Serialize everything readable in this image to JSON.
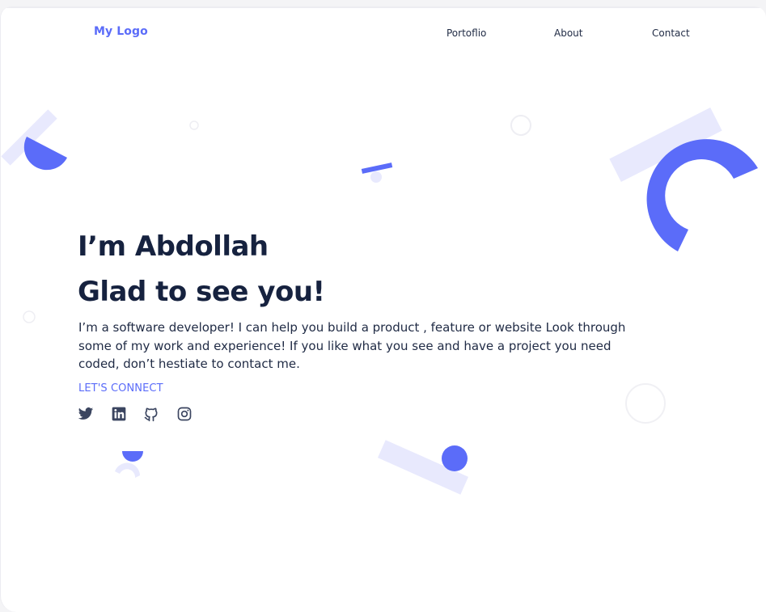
{
  "nav": {
    "logo": "My Logo",
    "links": [
      {
        "label": "Portoflio"
      },
      {
        "label": "About"
      },
      {
        "label": "Contact"
      }
    ]
  },
  "hero": {
    "line1": "I’m Abdollah",
    "line2": "Glad to see you!",
    "intro": "I’m a software developer! I can help you build a product , feature or website Look through some of my work and experience! If you like what you see and have a project you need coded, don’t hestiate to contact me.",
    "connect_label": "LET'S CONNECT"
  },
  "social": [
    {
      "icon": "twitter-icon"
    },
    {
      "icon": "linkedin-icon"
    },
    {
      "icon": "github-icon"
    },
    {
      "icon": "instagram-icon"
    }
  ],
  "colors": {
    "accent": "#5b6cf9",
    "accent_light": "#e8e9fd",
    "heading": "#16223f",
    "text": "#1f2a44",
    "icon": "#3b4560"
  }
}
